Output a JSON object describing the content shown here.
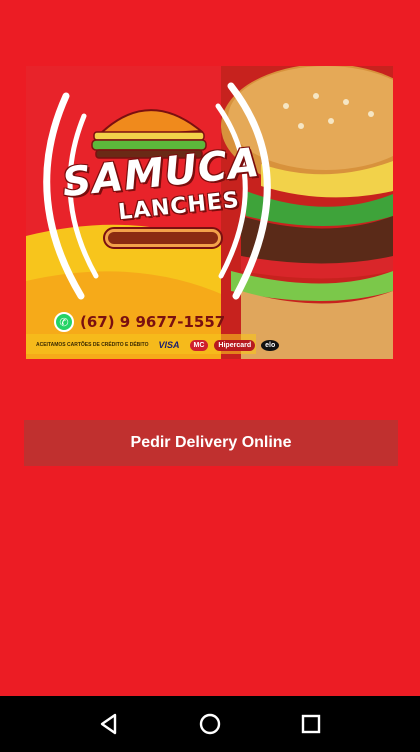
{
  "banner": {
    "brand": "SAMUCA",
    "subtitle": "LANCHES",
    "phone": "(67) 9 9677-1557",
    "cards_note": "ACEITAMOS CARTÕES DE CRÉDITO E DÉBITO",
    "card_visa": "VISA",
    "card_mastercard": "MC",
    "card_hipercard": "Hipercard",
    "card_elo": "elo"
  },
  "cta": {
    "label": "Pedir Delivery Online"
  },
  "colors": {
    "background": "#ec1c24",
    "button": "#c0302f",
    "navbar": "#000000"
  },
  "navbar": {
    "back_icon": "back-icon",
    "home_icon": "home-icon",
    "recents_icon": "recents-icon"
  }
}
